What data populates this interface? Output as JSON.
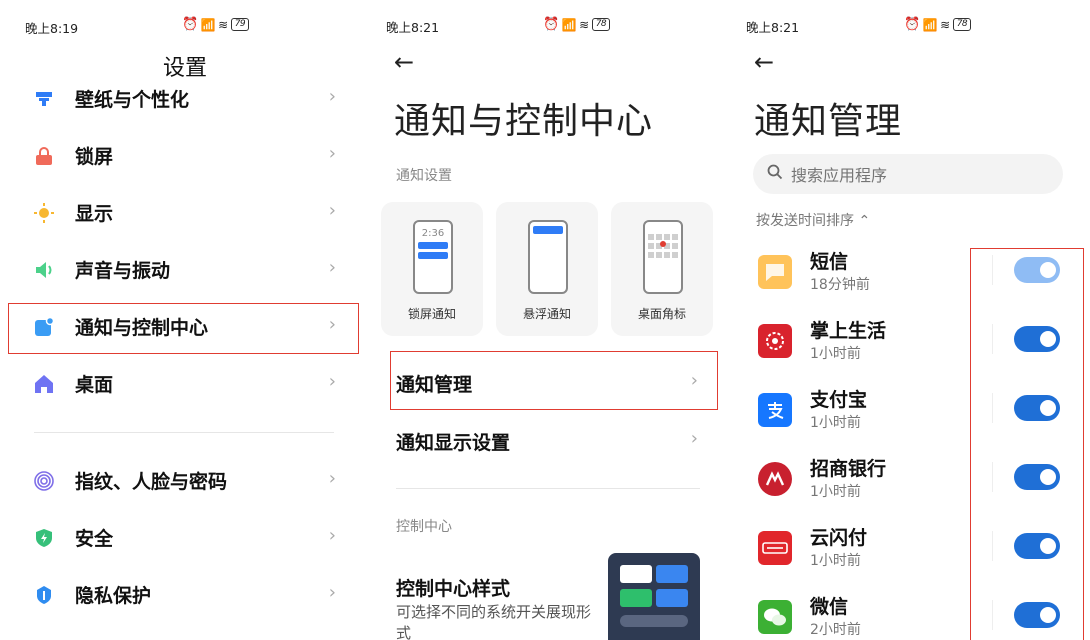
{
  "panel1": {
    "status_time": "晚上8:19",
    "battery": "79",
    "title": "设置",
    "items": [
      {
        "label": "壁纸与个性化",
        "icon": "palette-icon",
        "color": "#2f7cf6"
      },
      {
        "label": "锁屏",
        "icon": "lock-icon",
        "color": "#f06a5a"
      },
      {
        "label": "显示",
        "icon": "sun-icon",
        "color": "#f7b731"
      },
      {
        "label": "声音与振动",
        "icon": "speaker-icon",
        "color": "#4cd18a"
      },
      {
        "label": "通知与控制中心",
        "icon": "notification-icon",
        "color": "#3a9cf4"
      },
      {
        "label": "桌面",
        "icon": "home-icon",
        "color": "#6f73f3"
      },
      {
        "label": "指纹、人脸与密码",
        "icon": "fingerprint-icon",
        "color": "#7f6fe8"
      },
      {
        "label": "安全",
        "icon": "shield-icon",
        "color": "#36c07a"
      },
      {
        "label": "隐私保护",
        "icon": "privacy-icon",
        "color": "#2f8cf0"
      }
    ],
    "chevron": "›"
  },
  "panel2": {
    "status_time": "晚上8:21",
    "battery": "78",
    "back": "←",
    "title": "通知与控制中心",
    "section_notify": "通知设置",
    "cards": [
      {
        "label": "锁屏通知",
        "phone_time": "2:36"
      },
      {
        "label": "悬浮通知"
      },
      {
        "label": "桌面角标"
      }
    ],
    "menu": [
      {
        "label": "通知管理"
      },
      {
        "label": "通知显示设置"
      }
    ],
    "section_control": "控制中心",
    "control_style_title": "控制中心样式",
    "control_style_desc": "可选择不同的系统开关展现形式"
  },
  "panel3": {
    "status_time": "晚上8:21",
    "battery": "78",
    "back": "←",
    "title": "通知管理",
    "search_placeholder": "搜索应用程序",
    "sort_label": "按发送时间排序 ⌃",
    "apps": [
      {
        "name": "短信",
        "time": "18分钟前",
        "icon": "sms-icon",
        "icon_color": "#ffc35a",
        "toggle_color": "#8fbcf4"
      },
      {
        "name": "掌上生活",
        "time": "1小时前",
        "icon": "zhangshang-icon",
        "icon_color": "#d9232d",
        "toggle_color": "#1f6fd6"
      },
      {
        "name": "支付宝",
        "time": "1小时前",
        "icon": "alipay-icon",
        "icon_color": "#1677ff",
        "toggle_color": "#1f6fd6"
      },
      {
        "name": "招商银行",
        "time": "1小时前",
        "icon": "cmb-icon",
        "icon_color": "#c8202f",
        "toggle_color": "#1f6fd6"
      },
      {
        "name": "云闪付",
        "time": "1小时前",
        "icon": "unionpay-icon",
        "icon_color": "#e1262b",
        "toggle_color": "#1f6fd6"
      },
      {
        "name": "微信",
        "time": "2小时前",
        "icon": "wechat-icon",
        "icon_color": "#3cb034",
        "toggle_color": "#1f6fd6"
      }
    ]
  },
  "colors": {
    "highlight": "#e03c31",
    "toggle_on": "#1f6fd6"
  }
}
